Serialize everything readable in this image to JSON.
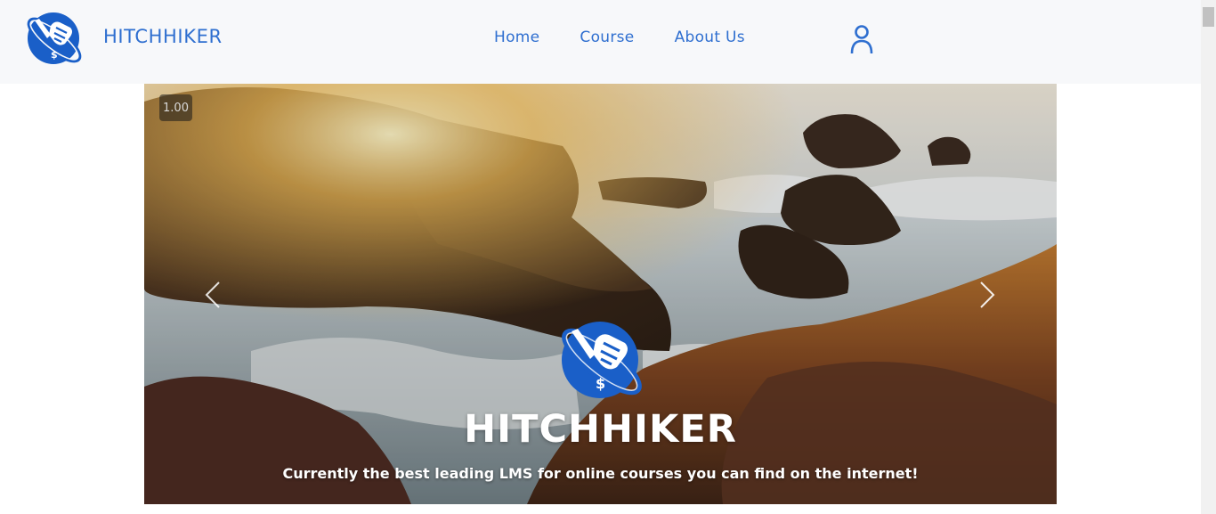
{
  "brand": {
    "name": "HITCHHIKER",
    "color": "#2f6fd0"
  },
  "nav": {
    "items": [
      {
        "label": "Home"
      },
      {
        "label": "Course"
      },
      {
        "label": "About Us"
      }
    ]
  },
  "header": {
    "user_icon": "user-icon"
  },
  "hero": {
    "speed_badge": "1.00",
    "title": "HITCHHIKER",
    "tagline": "Currently the best leading LMS for online courses you can find on the internet!",
    "prev_icon": "chevron-left-icon",
    "next_icon": "chevron-right-icon"
  },
  "colors": {
    "accent": "#2f6fd0",
    "logo_blue": "#1a5fc8",
    "header_bg": "#f7f8fa"
  }
}
